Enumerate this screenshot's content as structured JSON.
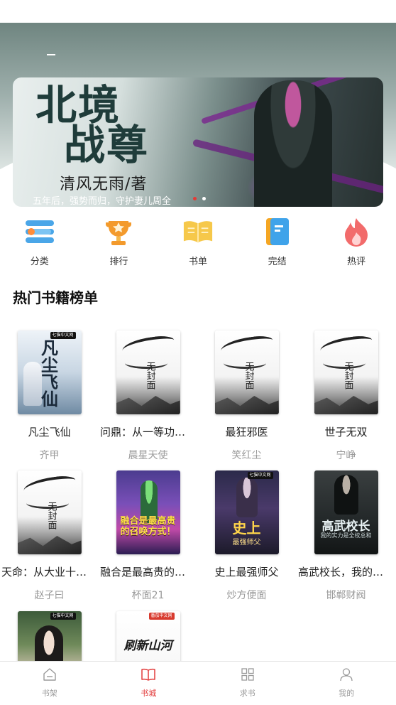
{
  "banner": {
    "title_line1": "北境",
    "title_line2": "战尊",
    "author": "清风无雨/著",
    "tagline": "五年后，强势而归，守护妻儿周全",
    "active_dot": 0,
    "dot_count": 2
  },
  "quick_menu": [
    {
      "label": "分类",
      "icon": "category-icon"
    },
    {
      "label": "排行",
      "icon": "trophy-icon"
    },
    {
      "label": "书单",
      "icon": "book-list-icon"
    },
    {
      "label": "完结",
      "icon": "finished-book-icon"
    },
    {
      "label": "热评",
      "icon": "flame-icon"
    }
  ],
  "section": {
    "title": "热门书籍榜单"
  },
  "books": [
    {
      "title": "凡尘飞仙",
      "author": "齐甲",
      "cover_text": "凡尘飞仙",
      "badge": "七猫中文网"
    },
    {
      "title": "问鼎：从一等功臣开始",
      "author": "晨星天使",
      "cover_text": "无封面"
    },
    {
      "title": "最狂邪医",
      "author": "笑红尘",
      "cover_text": "无封面"
    },
    {
      "title": "世子无双",
      "author": "宁峥",
      "cover_text": "无封面"
    },
    {
      "title": "天命：从大业十二年开始",
      "author": "赵子曰",
      "cover_text": "无封面"
    },
    {
      "title": "融合是最高贵的召唤方式",
      "author": "杯面21",
      "cover_text": "融合是最高贵的召唤方式！"
    },
    {
      "title": "史上最强师父",
      "author": "炒方便面",
      "cover_text": "史上",
      "cover_sub": "最强师父",
      "badge": "七猫中文网"
    },
    {
      "title": "高武校长，我的实力是全校总和",
      "author": "邯郸财阀",
      "cover_text": "高武校长",
      "cover_sub": "我的实力是全校总和"
    },
    {
      "title": "",
      "author": "",
      "badge": "七猫中文网"
    },
    {
      "title": "",
      "author": "",
      "cover_text": "刷新山河",
      "badge": "番茄中文网"
    }
  ],
  "tabbar": [
    {
      "label": "书架",
      "icon": "bookshelf-icon",
      "active": false
    },
    {
      "label": "书城",
      "icon": "bookstore-icon",
      "active": true
    },
    {
      "label": "求书",
      "icon": "grid-icon",
      "active": false
    },
    {
      "label": "我的",
      "icon": "profile-icon",
      "active": false
    }
  ],
  "colors": {
    "accent": "#e23b3b",
    "inactive_tab": "#9a9a9a",
    "author_text": "#9a9a9a"
  }
}
